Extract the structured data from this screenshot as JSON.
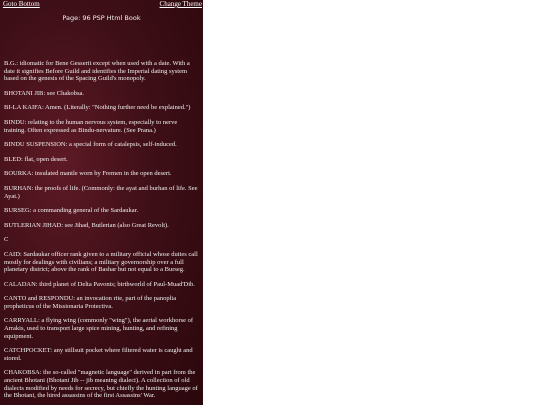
{
  "nav": {
    "goto_bottom": "Goto Bottom",
    "change_theme": "Change Theme"
  },
  "page_title": "Page: 96 PSP Html Book",
  "colors": {
    "background_dark_maroon": "#3f0f17",
    "text": "#f2f2f2",
    "outside": "#ffffff"
  },
  "entries": [
    "B.G.: idiomatic for Bene Gesserit except when used with a date. With a date it signifies Before Guild and identifies the Imperial dating system based on the genesis of the Spacing Guild's monopoly.",
    "BHOTANI JIB: see Chakobsa.",
    "BI-LA KAIFA: Amen. (Literally: \"Nothing further need be explained.\")",
    "BINDU: relating to the human nervous system, especially to nerve training. Often expressed as Bindu-nervature. (See Prana.)",
    "BINDU SUSPENSION: a special form of catalepsis, self-induced.",
    "BLED: flat, open desert.",
    "BOURKA: insulated mantle worn by Fremen in the open desert.",
    "BURHAN: the proofs of life. (Commonly: the ayat and burhan of life. See Ayat.)",
    "BURSEG: a commanding general of the Sardaukar.",
    "BUTLERIAN JIHAD: see Jihad, Butlerian (also Great Revolt).",
    "C",
    "CAID: Sardaukar officer rank given to a military official whose duties call mostly for dealings with civilians; a military governorship over a full planetary district; above the rank of Bashar but not equal to a Burseg.",
    "CALADAN: third planet of Delta Pavonis; birthworld of Paul-Muad'Dib.",
    "CANTO and RESPONDU: an invocation rite, part of the panoplia propheticus of the Missionaria Protectiva.",
    "CARRYALL: a flying wing (commonly \"wing\"), the aerial workhorse of Arrakis, used to transport large spice mining, hunting, and refining equipment.",
    "CATCHPOCKET: any stillsuit pocket where filtered water is caught and stored.",
    "CHAKOBSA: the so-called \"magnetic language\" derived in part from the ancient Bhotani (Bhotani Jib -- jib meaning dialect). A collection of old dialects modified by needs for secrecy, but chiefly the hunting language of the Bhotani, the hired assassins of the first Assassins' War."
  ]
}
